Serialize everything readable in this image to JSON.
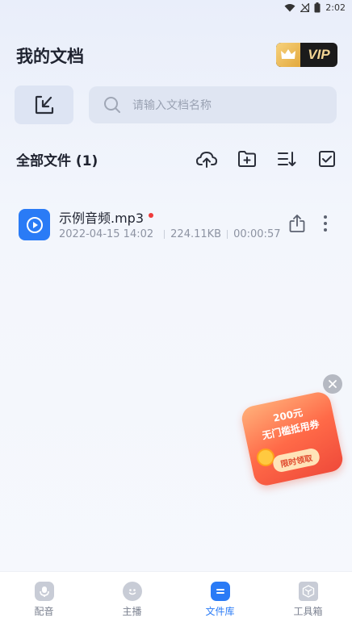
{
  "status": {
    "time": "2:02"
  },
  "header": {
    "title": "我的文档",
    "vip_label": "VIP"
  },
  "search": {
    "placeholder": "请输入文档名称"
  },
  "section": {
    "title": "全部文件 (1)"
  },
  "toolbar": {
    "icons": [
      "cloud-upload-icon",
      "new-folder-icon",
      "sort-icon",
      "multi-select-icon"
    ]
  },
  "files": [
    {
      "name": "示例音频.mp3",
      "date": "2022-04-15 14:02",
      "size": "224.11KB",
      "duration": "00:00:57",
      "unread": true
    }
  ],
  "promo": {
    "amount": "200元",
    "desc": "无门槛抵用券",
    "cta": "限时领取"
  },
  "nav": {
    "items": [
      {
        "label": "配音",
        "icon": "dubbing-icon",
        "active": false
      },
      {
        "label": "主播",
        "icon": "anchor-icon",
        "active": false
      },
      {
        "label": "文件库",
        "icon": "file-library-icon",
        "active": true
      },
      {
        "label": "工具箱",
        "icon": "toolbox-icon",
        "active": false
      }
    ]
  },
  "colors": {
    "accent": "#2a7bf6",
    "unread_dot": "#ef3b3b",
    "vip_gold": "#f3d594"
  }
}
